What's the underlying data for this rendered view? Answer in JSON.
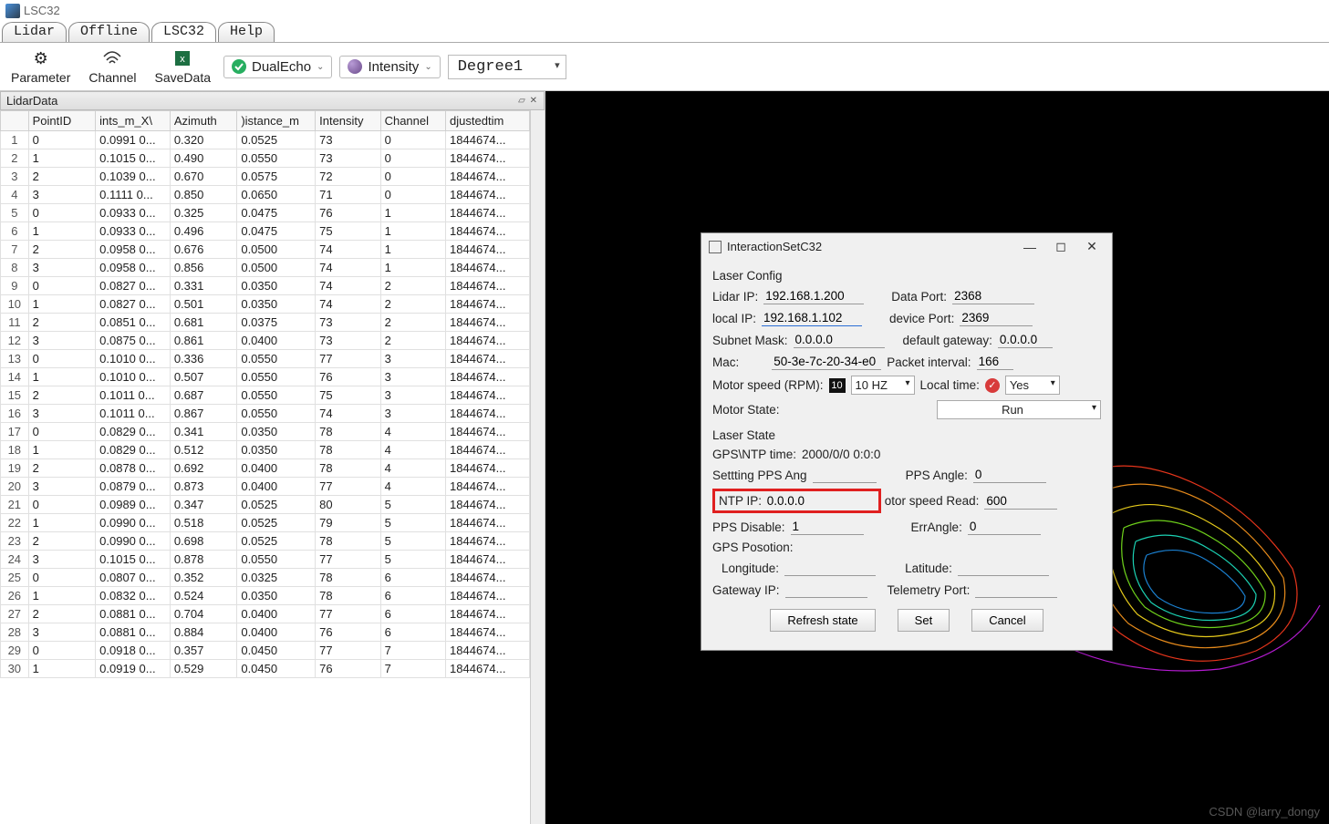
{
  "window_title": "LSC32",
  "tabs": [
    "Lidar",
    "Offline",
    "LSC32",
    "Help"
  ],
  "active_tab": "LSC32",
  "toolbar": {
    "parameter": "Parameter",
    "channel": "Channel",
    "savedata": "SaveData",
    "dualecho": "DualEcho",
    "intensity": "Intensity",
    "degree": "Degree1"
  },
  "panel_title": "LidarData",
  "columns": [
    "PointID",
    "ints_m_X\\",
    "Azimuth",
    ")istance_m",
    "Intensity",
    "Channel",
    "djustedtim"
  ],
  "rows": [
    {
      "n": 1,
      "c": [
        "0",
        "0.0991 0...",
        "0.320",
        "0.0525",
        "73",
        "0",
        "1844674..."
      ]
    },
    {
      "n": 2,
      "c": [
        "1",
        "0.1015 0...",
        "0.490",
        "0.0550",
        "73",
        "0",
        "1844674..."
      ]
    },
    {
      "n": 3,
      "c": [
        "2",
        "0.1039 0...",
        "0.670",
        "0.0575",
        "72",
        "0",
        "1844674..."
      ]
    },
    {
      "n": 4,
      "c": [
        "3",
        "0.1111 0...",
        "0.850",
        "0.0650",
        "71",
        "0",
        "1844674..."
      ]
    },
    {
      "n": 5,
      "c": [
        "0",
        "0.0933 0...",
        "0.325",
        "0.0475",
        "76",
        "1",
        "1844674..."
      ]
    },
    {
      "n": 6,
      "c": [
        "1",
        "0.0933 0...",
        "0.496",
        "0.0475",
        "75",
        "1",
        "1844674..."
      ]
    },
    {
      "n": 7,
      "c": [
        "2",
        "0.0958 0...",
        "0.676",
        "0.0500",
        "74",
        "1",
        "1844674..."
      ]
    },
    {
      "n": 8,
      "c": [
        "3",
        "0.0958 0...",
        "0.856",
        "0.0500",
        "74",
        "1",
        "1844674..."
      ]
    },
    {
      "n": 9,
      "c": [
        "0",
        "0.0827 0...",
        "0.331",
        "0.0350",
        "74",
        "2",
        "1844674..."
      ]
    },
    {
      "n": 10,
      "c": [
        "1",
        "0.0827 0...",
        "0.501",
        "0.0350",
        "74",
        "2",
        "1844674..."
      ]
    },
    {
      "n": 11,
      "c": [
        "2",
        "0.0851 0...",
        "0.681",
        "0.0375",
        "73",
        "2",
        "1844674..."
      ]
    },
    {
      "n": 12,
      "c": [
        "3",
        "0.0875 0...",
        "0.861",
        "0.0400",
        "73",
        "2",
        "1844674..."
      ]
    },
    {
      "n": 13,
      "c": [
        "0",
        "0.1010 0...",
        "0.336",
        "0.0550",
        "77",
        "3",
        "1844674..."
      ]
    },
    {
      "n": 14,
      "c": [
        "1",
        "0.1010 0...",
        "0.507",
        "0.0550",
        "76",
        "3",
        "1844674..."
      ]
    },
    {
      "n": 15,
      "c": [
        "2",
        "0.1011 0...",
        "0.687",
        "0.0550",
        "75",
        "3",
        "1844674..."
      ]
    },
    {
      "n": 16,
      "c": [
        "3",
        "0.1011 0...",
        "0.867",
        "0.0550",
        "74",
        "3",
        "1844674..."
      ]
    },
    {
      "n": 17,
      "c": [
        "0",
        "0.0829 0...",
        "0.341",
        "0.0350",
        "78",
        "4",
        "1844674..."
      ]
    },
    {
      "n": 18,
      "c": [
        "1",
        "0.0829 0...",
        "0.512",
        "0.0350",
        "78",
        "4",
        "1844674..."
      ]
    },
    {
      "n": 19,
      "c": [
        "2",
        "0.0878 0...",
        "0.692",
        "0.0400",
        "78",
        "4",
        "1844674..."
      ]
    },
    {
      "n": 20,
      "c": [
        "3",
        "0.0879 0...",
        "0.873",
        "0.0400",
        "77",
        "4",
        "1844674..."
      ]
    },
    {
      "n": 21,
      "c": [
        "0",
        "0.0989 0...",
        "0.347",
        "0.0525",
        "80",
        "5",
        "1844674..."
      ]
    },
    {
      "n": 22,
      "c": [
        "1",
        "0.0990 0...",
        "0.518",
        "0.0525",
        "79",
        "5",
        "1844674..."
      ]
    },
    {
      "n": 23,
      "c": [
        "2",
        "0.0990 0...",
        "0.698",
        "0.0525",
        "78",
        "5",
        "1844674..."
      ]
    },
    {
      "n": 24,
      "c": [
        "3",
        "0.1015 0...",
        "0.878",
        "0.0550",
        "77",
        "5",
        "1844674..."
      ]
    },
    {
      "n": 25,
      "c": [
        "0",
        "0.0807 0...",
        "0.352",
        "0.0325",
        "78",
        "6",
        "1844674..."
      ]
    },
    {
      "n": 26,
      "c": [
        "1",
        "0.0832 0...",
        "0.524",
        "0.0350",
        "78",
        "6",
        "1844674..."
      ]
    },
    {
      "n": 27,
      "c": [
        "2",
        "0.0881 0...",
        "0.704",
        "0.0400",
        "77",
        "6",
        "1844674..."
      ]
    },
    {
      "n": 28,
      "c": [
        "3",
        "0.0881 0...",
        "0.884",
        "0.0400",
        "76",
        "6",
        "1844674..."
      ]
    },
    {
      "n": 29,
      "c": [
        "0",
        "0.0918 0...",
        "0.357",
        "0.0450",
        "77",
        "7",
        "1844674..."
      ]
    },
    {
      "n": 30,
      "c": [
        "1",
        "0.0919 0...",
        "0.529",
        "0.0450",
        "76",
        "7",
        "1844674..."
      ]
    }
  ],
  "dialog": {
    "title": "InteractionSetC32",
    "laser_config": "Laser Config",
    "lidar_ip_l": "Lidar IP:",
    "lidar_ip": "192.168.1.200",
    "data_port_l": "Data Port:",
    "data_port": "2368",
    "local_ip_l": "local IP:",
    "local_ip": "192.168.1.102",
    "device_port_l": "device Port:",
    "device_port": "2369",
    "subnet_l": "Subnet Mask:",
    "subnet": "0.0.0.0",
    "gateway_l": "default gateway:",
    "gateway": "0.0.0.0",
    "mac_l": "Mac:",
    "mac": "50-3e-7c-20-34-e0",
    "pktint_l": "Packet interval:",
    "pktint": "166",
    "motor_l": "Motor speed (RPM):",
    "motor_chip": "10",
    "motor_val": "10 HZ",
    "localtime_l": "Local time:",
    "localtime_val": "Yes",
    "mstate_l": "Motor State:",
    "mstate_val": "Run",
    "laser_state": "Laser State",
    "gpsntp_l": "GPS\\NTP time:",
    "gpsntp": "2000/0/0 0:0:0",
    "setpps_l": "Settting PPS Ang",
    "ppsang_l": "PPS Angle:",
    "ppsang": "0",
    "ntpip_l": "NTP IP:",
    "ntpip": "0.0.0.0",
    "msread_l": "otor speed Read:",
    "msread": "600",
    "ppsdis_l": "PPS Disable:",
    "ppsdis": "1",
    "errang_l": "ErrAngle:",
    "errang": "0",
    "gpspos": "GPS Posotion:",
    "lon_l": "Longitude:",
    "lat_l": "Latitude:",
    "gwip_l": "Gateway IP:",
    "tport_l": "Telemetry Port:",
    "btn_refresh": "Refresh state",
    "btn_set": "Set",
    "btn_cancel": "Cancel"
  },
  "watermark": "CSDN @larry_dongy"
}
